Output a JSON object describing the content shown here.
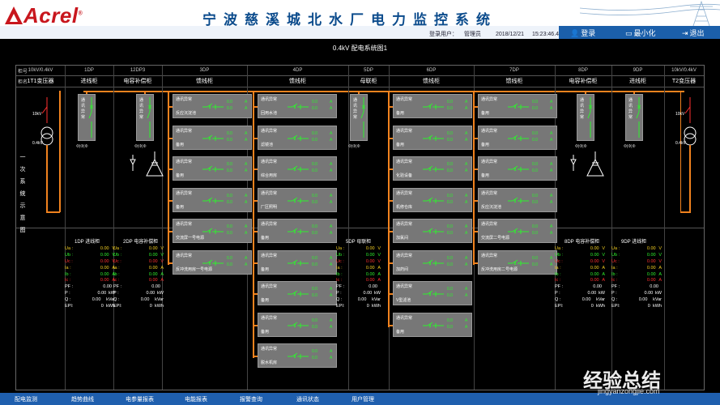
{
  "header": {
    "brand": "Acrel",
    "title": "宁波慈溪城北水厂电力监控系统",
    "user_label": "登录用户：",
    "user": "管理员",
    "date": "2018/12/21",
    "time": "15:23:46.4",
    "login": "登录",
    "minimize": "最小化",
    "exit": "退出"
  },
  "page": {
    "subtitle": "0.4kV 配电系统图1"
  },
  "grid": {
    "row_labels": [
      "柜号",
      "柜名"
    ],
    "side_label": "一次系统示意图",
    "columns": [
      {
        "no": "10kV/0.4kV",
        "name": "1T1变压器"
      },
      {
        "no": "1DP",
        "name": "进线柜"
      },
      {
        "no": "12DP3",
        "name": "电容补偿柜"
      },
      {
        "no": "3DP",
        "name": "馈线柜"
      },
      {
        "no": "4DP",
        "name": "馈线柜"
      },
      {
        "no": "5DP",
        "name": "母联柜"
      },
      {
        "no": "6DP",
        "name": "馈线柜"
      },
      {
        "no": "7DP",
        "name": "馈线柜"
      },
      {
        "no": "8DP",
        "name": "电容补偿柜"
      },
      {
        "no": "9DP",
        "name": "进线柜"
      },
      {
        "no": "10kV/0.4kV",
        "name": "T2变压器"
      }
    ]
  },
  "transformers": {
    "left": {
      "hv": "10kV",
      "lv": "0.4kV"
    },
    "right": {
      "hv": "10kV",
      "lv": "0.4kV"
    }
  },
  "vertical_cards": {
    "text": "通讯异常",
    "switch_symbol": "Φ|Φ|Φ"
  },
  "feeders": {
    "status": "通讯异常",
    "value": "0.0",
    "unit": "A",
    "col3": [
      "反应沉淀池",
      "备用",
      "备用",
      "备用",
      "交流屏一号电源",
      "反冲洗用房一号电源"
    ],
    "col4": [
      "回用水池",
      "滤镜池",
      "综合用房",
      "厂区照明",
      "备用",
      "备用",
      "备用",
      "备用",
      "脱水机房"
    ],
    "col6": [
      "备用",
      "备用",
      "化验设备",
      "机修仓库",
      "加氯间",
      "加药间",
      "V型滤池",
      "备用"
    ],
    "col7": [
      "备用",
      "备用",
      "备用",
      "反应沉淀池",
      "交流屏二号电源",
      "反冲洗用房二号电源"
    ]
  },
  "meters": {
    "labels": [
      "Ua :",
      "Ub :",
      "Uc :",
      "Ia :",
      "Ib :",
      "Ic :",
      "PF :",
      "P  :",
      "Q  :",
      "EPI:"
    ],
    "units": [
      "V",
      "V",
      "V",
      "A",
      "A",
      "A",
      "",
      "kW",
      "kVar",
      "kWh"
    ],
    "label_colors": [
      "#f5d020",
      "#2ef22e",
      "#ff3030",
      "#f5d020",
      "#2ef22e",
      "#ff3030",
      "#ffffff",
      "#ffffff",
      "#ffffff",
      "#ffffff"
    ],
    "blocks": [
      {
        "title": "1DP 进线柜",
        "values": [
          "0.00",
          "0.00",
          "0.00",
          "0.00",
          "0.00",
          "0.00",
          "0.00",
          "0.00",
          "0.00",
          "0"
        ]
      },
      {
        "title": "2DP 电容补偿柜",
        "values": [
          "0.00",
          "0.00",
          "0.00",
          "0.00",
          "0.00",
          "0.00",
          "0.00",
          "0.00",
          "0.00",
          "0"
        ]
      },
      {
        "title": "5DP 母联柜",
        "values": [
          "0.00",
          "0.00",
          "0.00",
          "0.00",
          "0.00",
          "0.00",
          "0.00",
          "0.00",
          "0.00",
          "0"
        ]
      },
      {
        "title": "8DP 电容补偿柜",
        "values": [
          "0.00",
          "0.00",
          "0.00",
          "0.00",
          "0.00",
          "0.00",
          "0.00",
          "0.00",
          "0.00",
          "0"
        ]
      },
      {
        "title": "9DP 进线柜",
        "values": [
          "0.00",
          "0.00",
          "0.00",
          "0.00",
          "0.00",
          "0.00",
          "0.00",
          "0.00",
          "0.00",
          "0"
        ]
      }
    ]
  },
  "footer": {
    "items": [
      "配电监测",
      "趋势曲线",
      "电参量报表",
      "电能报表",
      "报警查询",
      "通讯状态",
      "用户管理"
    ]
  },
  "watermark": {
    "main": "经验总结",
    "url": "jingyanzongjie.com"
  },
  "colors": {
    "bus": "#f0821e",
    "brand": "#c8161d",
    "title": "#0b4b8c",
    "ok": "#2ef22e",
    "nav": "#1f5fae"
  }
}
